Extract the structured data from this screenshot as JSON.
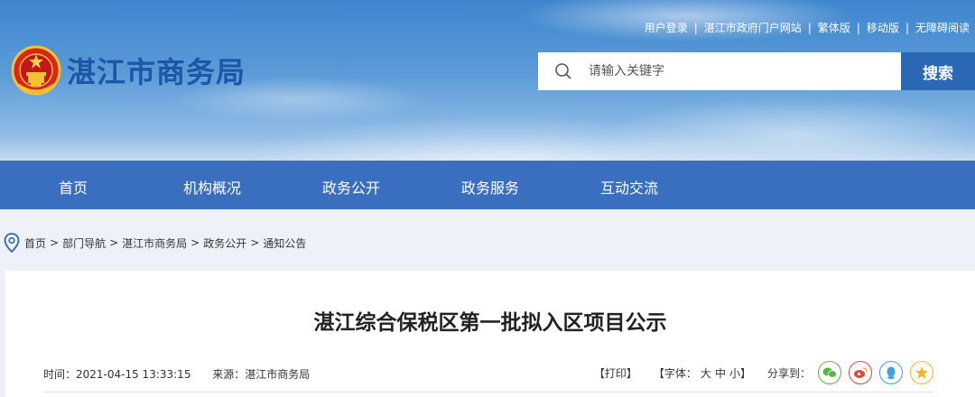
{
  "header": {
    "top_links": [
      "用户登录",
      "湛江市政府门户网站",
      "繁体版",
      "移动版",
      "无障碍阅读"
    ],
    "site_title": "湛江市商务局",
    "search": {
      "placeholder": "请输入关键字",
      "button_label": "搜索"
    }
  },
  "nav": {
    "items": [
      "首页",
      "机构概况",
      "政务公开",
      "政务服务",
      "互动交流"
    ]
  },
  "breadcrumb": [
    "首页",
    "部门导航",
    "湛江市商务局",
    "政务公开",
    "通知公告"
  ],
  "article": {
    "title": "湛江综合保税区第一批拟入区项目公示",
    "time": "时间：2021-04-15 13:33:15",
    "source": "来源：湛江市商务局",
    "print_label": "【打印】",
    "font_label": "【字体：",
    "font_sizes": [
      "大",
      "中",
      "小"
    ],
    "font_close": "】",
    "share_label": "分享到："
  },
  "colors": {
    "nav_bg": "#3a6fc0",
    "search_button": "#2a67b5",
    "title_blue": "#1d56a8",
    "share_wechat": "#5ab342",
    "share_weibo": "#e4453c",
    "share_qq": "#3ea0e6",
    "share_qzone": "#f3b71d"
  },
  "icons": [
    "national-emblem",
    "search-icon",
    "location-icon",
    "wechat-icon",
    "weibo-icon",
    "qq-icon",
    "qzone-icon"
  ]
}
